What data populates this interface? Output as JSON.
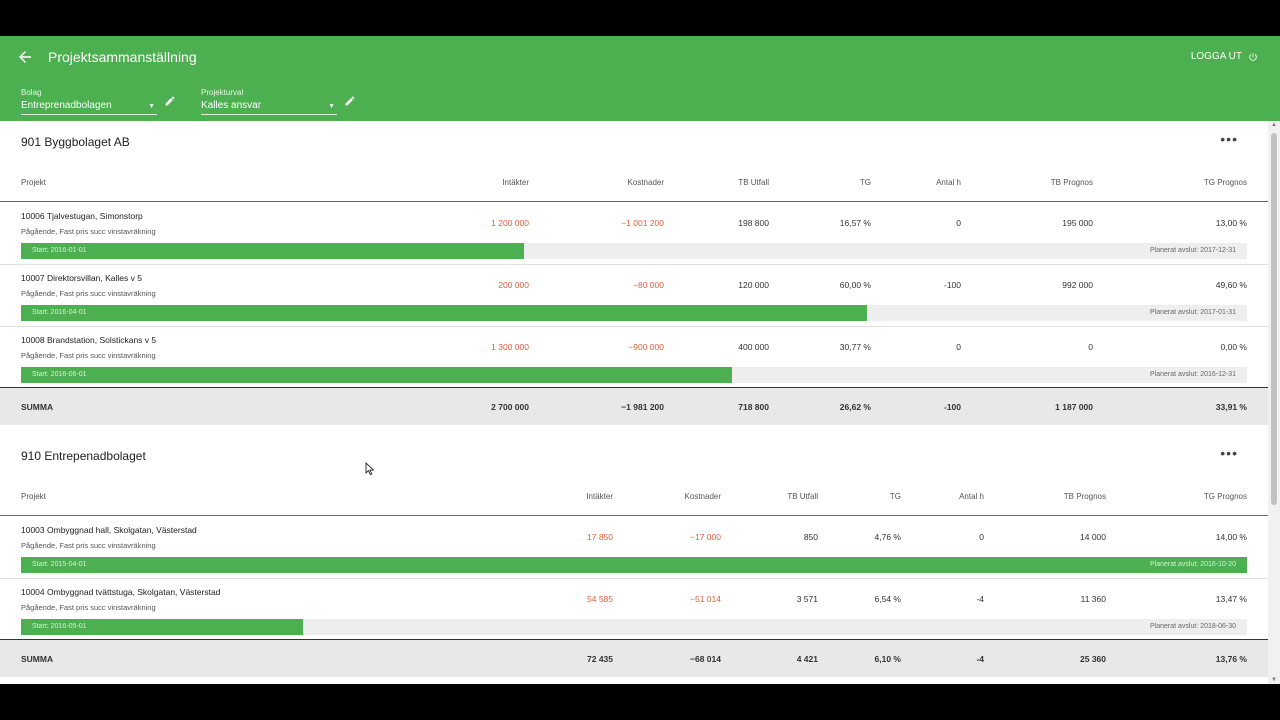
{
  "header": {
    "title": "Projektsammanställning",
    "logout": "LOGGA UT"
  },
  "filters": {
    "company": {
      "label": "Bolag",
      "value": "Entreprenadbolagen"
    },
    "selection": {
      "label": "Projekturval",
      "value": "Kalles ansvar"
    }
  },
  "colors": {
    "primary": "#4caf50",
    "negative": "#e25d3c"
  },
  "sections": [
    {
      "title": "901 Byggbolaget AB",
      "columns": [
        "Projekt",
        "Intäkter",
        "Kostnader",
        "TB Utfall",
        "TG",
        "Antal h",
        "TB Prognos",
        "TG Prognos"
      ],
      "rows": [
        {
          "name": "10006 Tjalvestugan, Simonstorp",
          "status": "Pågående, Fast pris succ vinstavräkning",
          "intakter": "1 200 000",
          "kostnader": "−1 001 200",
          "tb_utfall": "198 800",
          "tg": "16,57 %",
          "antal_h": "0",
          "tb_prognos": "195 000",
          "tg_prognos": "13,00 %",
          "start": "Start: 2016-01-01",
          "end": "Planerat avslut: 2017-12-31",
          "progress": 0.41
        },
        {
          "name": "10007 Direktorsvillan, Kalles v 5",
          "status": "Pågående, Fast pris succ vinstavräkning",
          "intakter": "200 000",
          "kostnader": "−80 000",
          "tb_utfall": "120 000",
          "tg": "60,00 %",
          "antal_h": "-100",
          "tb_prognos": "992 000",
          "tg_prognos": "49,60 %",
          "start": "Start: 2016-04-01",
          "end": "Planerat avslut: 2017-01-31",
          "progress": 0.69
        },
        {
          "name": "10008 Brandstation, Solstickans v 5",
          "status": "Pågående, Fast pris succ vinstavräkning",
          "intakter": "1 300 000",
          "kostnader": "−900 000",
          "tb_utfall": "400 000",
          "tg": "30,77 %",
          "antal_h": "0",
          "tb_prognos": "0",
          "tg_prognos": "0,00 %",
          "start": "Start: 2016-06-01",
          "end": "Planerat avslut: 2016-12-31",
          "progress": 0.58
        }
      ],
      "summary": {
        "label": "SUMMA",
        "intakter": "2 700 000",
        "kostnader": "−1 981 200",
        "tb_utfall": "718 800",
        "tg": "26,62 %",
        "antal_h": "-100",
        "tb_prognos": "1 187 000",
        "tg_prognos": "33,91 %"
      }
    },
    {
      "title": "910 Entrepenadbolaget",
      "columns": [
        "Projekt",
        "Intäkter",
        "Kostnader",
        "TB Utfall",
        "TG",
        "Antal h",
        "TB Prognos",
        "TG Prognos"
      ],
      "rows": [
        {
          "name": "10003 Ombyggnad hall, Skolgatan, Västerstad",
          "status": "Pågående, Fast pris succ vinstavräkning",
          "intakter": "17 850",
          "kostnader": "−17 000",
          "tb_utfall": "850",
          "tg": "4,76 %",
          "antal_h": "0",
          "tb_prognos": "14 000",
          "tg_prognos": "14,00 %",
          "start": "Start: 2015-04-01",
          "end": "Planerat avslut: 2016-10-20",
          "progress": 1.0
        },
        {
          "name": "10004 Ombyggnad tvättstuga, Skolgatan, Västerstad",
          "status": "Pågående, Fast pris succ vinstavräkning",
          "intakter": "54 585",
          "kostnader": "−51 014",
          "tb_utfall": "3 571",
          "tg": "6,54 %",
          "antal_h": "-4",
          "tb_prognos": "11 360",
          "tg_prognos": "13,47 %",
          "start": "Start: 2016-05-01",
          "end": "Planerat avslut: 2018-06-30",
          "progress": 0.23
        }
      ],
      "summary": {
        "label": "SUMMA",
        "intakter": "72 435",
        "kostnader": "−68 014",
        "tb_utfall": "4 421",
        "tg": "6,10 %",
        "antal_h": "-4",
        "tb_prognos": "25 360",
        "tg_prognos": "13,76 %"
      }
    }
  ]
}
